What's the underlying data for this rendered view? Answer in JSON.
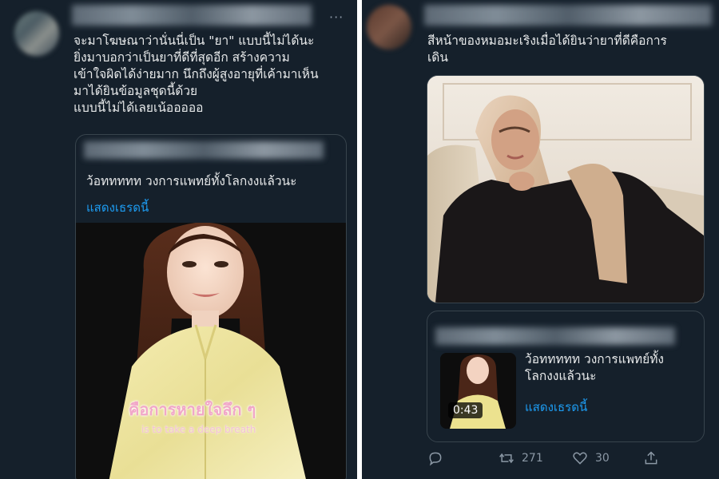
{
  "left_tweet": {
    "more_icon": "···",
    "text": "จะมาโฆษณาว่านั่นนี่เป็น \"ยา\" แบบนี้ไม่ได้นะ\nยิ่งมาบอกว่าเป็นยาที่ดีที่สุดอีก สร้างความ\nเข้าใจผิดได้ง่ายมาก นึกถึงผู้สูงอายุที่เค้ามาเห็น\nมาได้ยินข้อมูลชุดนี้ด้วย\nแบบนี้ไม่ได้เลยเน้อออออ",
    "quote": {
      "title": "ว้อททททท วงการแพทย์ทั้งโลกงงแล้วนะ",
      "link": "แสดงเธรดนี้",
      "caption_th": "คือการหายใจลึก ๆ",
      "caption_en": "is to take a deep breath"
    }
  },
  "right_tweet": {
    "text": "สีหน้าของหมอมะเริงเมื่อได้ยินว่ายาที่ดีคือการ\nเดิน",
    "quote": {
      "title": "ว้อททททท วงการแพทย์ทั้ง\nโลกงงแล้วนะ",
      "link": "แสดงเธรดนี้",
      "duration": "0:43"
    },
    "actions": {
      "retweets": "271",
      "likes": "30"
    }
  },
  "colors": {
    "background": "#15202b",
    "text": "#e7e9ea",
    "link": "#1d9bf0",
    "muted": "#8b98a5",
    "border": "#38444d"
  }
}
